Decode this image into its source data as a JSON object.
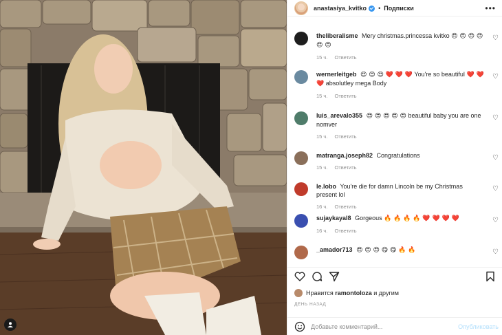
{
  "post": {
    "username": "anastasiya_kvitko",
    "follow_label": "Подписки",
    "more_icon": "more-horizontal-icon",
    "likes_prefix": "Нравится",
    "likes_user": "ramontoloza",
    "likes_suffix": "и другим",
    "date": "ДЕНЬ НАЗАД"
  },
  "comments": [
    {
      "user": "theliberalisme",
      "text": "Mery christmas.princessa kvitko",
      "emoji": "😍 😍 😍 😍 😍 😍",
      "time": "15 ч.",
      "reply": "Ответить",
      "avatar_color": "#1e1e1e"
    },
    {
      "user": "wernerleitgeb",
      "text": "You're so beautiful",
      "emoji_before": "😍 😍 😍 ❤️ ❤️ ❤️",
      "emoji_after": "❤️ ❤️ ❤️",
      "text2": "absolutley mega Body",
      "time": "15 ч.",
      "reply": "Ответить",
      "avatar_color": "#6a8aa0"
    },
    {
      "user": "luis_arevalo355",
      "emoji": "😍 😍 😍 😍 😍",
      "text": "beautiful baby you are one nomver",
      "time": "15 ч.",
      "reply": "Ответить",
      "avatar_color": "#4f7c6a"
    },
    {
      "user": "matranga.joseph82",
      "text": "Congratulations",
      "time": "15 ч.",
      "reply": "Ответить",
      "avatar_color": "#8a6f5a"
    },
    {
      "user": "le.lobo",
      "text": "You're die for damn Lincoln be my Christmas present lol",
      "time": "16 ч.",
      "reply": "Ответить",
      "avatar_color": "#c03b2b"
    },
    {
      "user": "sujaykayal8",
      "text": "Gorgeous",
      "emoji": "🔥 🔥 🔥 🔥 ❤️ ❤️ ❤️ ❤️",
      "time": "16 ч.",
      "reply": "Ответить",
      "avatar_color": "#3a4fb0"
    },
    {
      "user": "_amador713",
      "emoji": "😍 😍 😍 😋 😋 🔥 🔥",
      "time": "",
      "reply": "",
      "avatar_color": "#b0694a"
    }
  ],
  "actions": {
    "like_icon": "heart-icon",
    "comment_icon": "comment-icon",
    "share_icon": "send-icon",
    "save_icon": "bookmark-icon"
  },
  "composer": {
    "placeholder": "Добавьте комментарий...",
    "publish_label": "Опубликовать",
    "emoji_icon": "smile-icon"
  }
}
